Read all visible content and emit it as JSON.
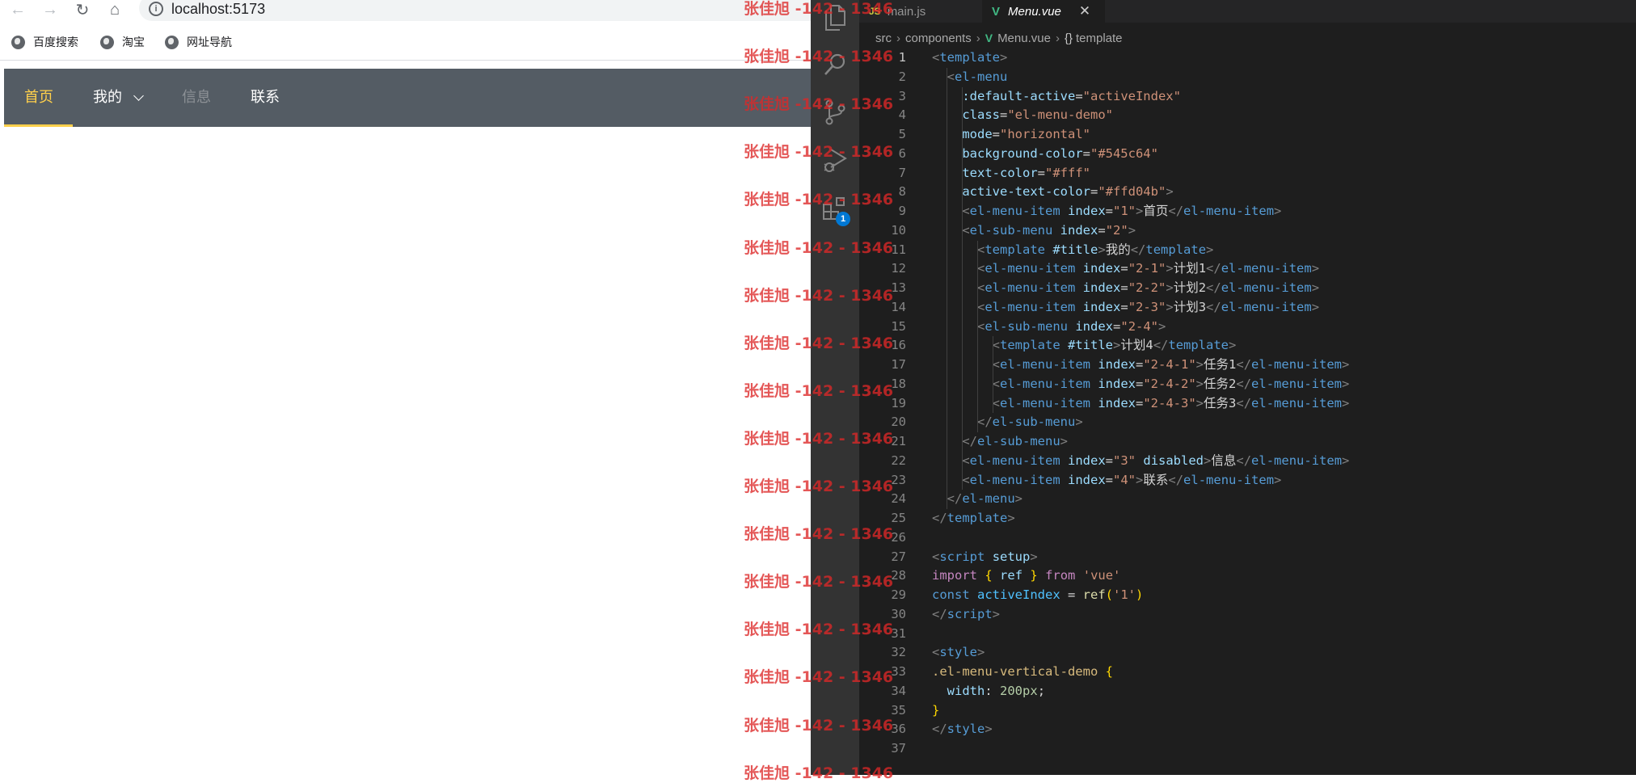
{
  "browser": {
    "nav": {
      "back_icon": "←",
      "forward_icon": "→",
      "reload_icon": "↻",
      "home_icon": "⌂"
    },
    "url": "localhost:5173",
    "bookmarks": [
      "百度搜索",
      "淘宝",
      "网址导航"
    ],
    "menu": {
      "items": [
        {
          "label": "首页",
          "state": "active"
        },
        {
          "label": "我的",
          "state": "submenu"
        },
        {
          "label": "信息",
          "state": "disabled"
        },
        {
          "label": "联系",
          "state": "normal"
        }
      ],
      "background_color": "#545c64",
      "text_color": "#fff",
      "active_text_color": "#ffd04b"
    }
  },
  "watermark": {
    "text": "张佳旭 -142 - 1346",
    "count": 17
  },
  "vscode": {
    "activity_icons": [
      "files-icon",
      "search-icon",
      "source-control-icon",
      "run-debug-icon",
      "extensions-icon"
    ],
    "extensions_badge": "1",
    "tabs": [
      {
        "badge": "JS",
        "label": "main.js",
        "active": false
      },
      {
        "badge": "V",
        "label": "Menu.vue",
        "active": true,
        "close": "✕"
      }
    ],
    "breadcrumbs": [
      "src",
      "components",
      "Menu.vue",
      "template"
    ],
    "current_line": 1,
    "code_lines": [
      [
        [
          "t-br",
          "<"
        ],
        [
          "t-tag",
          "template"
        ],
        [
          "t-br",
          ">"
        ]
      ],
      [
        [
          "",
          "  "
        ],
        [
          "t-br",
          "<"
        ],
        [
          "t-tag",
          "el-menu"
        ]
      ],
      [
        [
          "",
          "    "
        ],
        [
          "t-attr",
          ":default-active"
        ],
        [
          "",
          "="
        ],
        [
          "t-str",
          "\"activeIndex\""
        ]
      ],
      [
        [
          "",
          "    "
        ],
        [
          "t-attr",
          "class"
        ],
        [
          "",
          "="
        ],
        [
          "t-str",
          "\"el-menu-demo\""
        ]
      ],
      [
        [
          "",
          "    "
        ],
        [
          "t-attr",
          "mode"
        ],
        [
          "",
          "="
        ],
        [
          "t-str",
          "\"horizontal\""
        ]
      ],
      [
        [
          "",
          "    "
        ],
        [
          "t-attr",
          "background-color"
        ],
        [
          "",
          "="
        ],
        [
          "t-str",
          "\"#545c64\""
        ]
      ],
      [
        [
          "",
          "    "
        ],
        [
          "t-attr",
          "text-color"
        ],
        [
          "",
          "="
        ],
        [
          "t-str",
          "\"#fff\""
        ]
      ],
      [
        [
          "",
          "    "
        ],
        [
          "t-attr",
          "active-text-color"
        ],
        [
          "",
          "="
        ],
        [
          "t-str",
          "\"#ffd04b\""
        ],
        [
          "t-br",
          ">"
        ]
      ],
      [
        [
          "",
          "    "
        ],
        [
          "t-br",
          "<"
        ],
        [
          "t-tag",
          "el-menu-item"
        ],
        [
          "",
          " "
        ],
        [
          "t-attr",
          "index"
        ],
        [
          "",
          "="
        ],
        [
          "t-str",
          "\"1\""
        ],
        [
          "t-br",
          ">"
        ],
        [
          "",
          "首页"
        ],
        [
          "t-br",
          "</"
        ],
        [
          "t-tag",
          "el-menu-item"
        ],
        [
          "t-br",
          ">"
        ]
      ],
      [
        [
          "",
          "    "
        ],
        [
          "t-br",
          "<"
        ],
        [
          "t-tag",
          "el-sub-menu"
        ],
        [
          "",
          " "
        ],
        [
          "t-attr",
          "index"
        ],
        [
          "",
          "="
        ],
        [
          "t-str",
          "\"2\""
        ],
        [
          "t-br",
          ">"
        ]
      ],
      [
        [
          "",
          "      "
        ],
        [
          "t-br",
          "<"
        ],
        [
          "t-tag",
          "template"
        ],
        [
          "",
          " "
        ],
        [
          "t-attr",
          "#title"
        ],
        [
          "t-br",
          ">"
        ],
        [
          "",
          "我的"
        ],
        [
          "t-br",
          "</"
        ],
        [
          "t-tag",
          "template"
        ],
        [
          "t-br",
          ">"
        ]
      ],
      [
        [
          "",
          "      "
        ],
        [
          "t-br",
          "<"
        ],
        [
          "t-tag",
          "el-menu-item"
        ],
        [
          "",
          " "
        ],
        [
          "t-attr",
          "index"
        ],
        [
          "",
          "="
        ],
        [
          "t-str",
          "\"2-1\""
        ],
        [
          "t-br",
          ">"
        ],
        [
          "",
          "计划1"
        ],
        [
          "t-br",
          "</"
        ],
        [
          "t-tag",
          "el-menu-item"
        ],
        [
          "t-br",
          ">"
        ]
      ],
      [
        [
          "",
          "      "
        ],
        [
          "t-br",
          "<"
        ],
        [
          "t-tag",
          "el-menu-item"
        ],
        [
          "",
          " "
        ],
        [
          "t-attr",
          "index"
        ],
        [
          "",
          "="
        ],
        [
          "t-str",
          "\"2-2\""
        ],
        [
          "t-br",
          ">"
        ],
        [
          "",
          "计划2"
        ],
        [
          "t-br",
          "</"
        ],
        [
          "t-tag",
          "el-menu-item"
        ],
        [
          "t-br",
          ">"
        ]
      ],
      [
        [
          "",
          "      "
        ],
        [
          "t-br",
          "<"
        ],
        [
          "t-tag",
          "el-menu-item"
        ],
        [
          "",
          " "
        ],
        [
          "t-attr",
          "index"
        ],
        [
          "",
          "="
        ],
        [
          "t-str",
          "\"2-3\""
        ],
        [
          "t-br",
          ">"
        ],
        [
          "",
          "计划3"
        ],
        [
          "t-br",
          "</"
        ],
        [
          "t-tag",
          "el-menu-item"
        ],
        [
          "t-br",
          ">"
        ]
      ],
      [
        [
          "",
          "      "
        ],
        [
          "t-br",
          "<"
        ],
        [
          "t-tag",
          "el-sub-menu"
        ],
        [
          "",
          " "
        ],
        [
          "t-attr",
          "index"
        ],
        [
          "",
          "="
        ],
        [
          "t-str",
          "\"2-4\""
        ],
        [
          "t-br",
          ">"
        ]
      ],
      [
        [
          "",
          "        "
        ],
        [
          "t-br",
          "<"
        ],
        [
          "t-tag",
          "template"
        ],
        [
          "",
          " "
        ],
        [
          "t-attr",
          "#title"
        ],
        [
          "t-br",
          ">"
        ],
        [
          "",
          "计划4"
        ],
        [
          "t-br",
          "</"
        ],
        [
          "t-tag",
          "template"
        ],
        [
          "t-br",
          ">"
        ]
      ],
      [
        [
          "",
          "        "
        ],
        [
          "t-br",
          "<"
        ],
        [
          "t-tag",
          "el-menu-item"
        ],
        [
          "",
          " "
        ],
        [
          "t-attr",
          "index"
        ],
        [
          "",
          "="
        ],
        [
          "t-str",
          "\"2-4-1\""
        ],
        [
          "t-br",
          ">"
        ],
        [
          "",
          "任务1"
        ],
        [
          "t-br",
          "</"
        ],
        [
          "t-tag",
          "el-menu-item"
        ],
        [
          "t-br",
          ">"
        ]
      ],
      [
        [
          "",
          "        "
        ],
        [
          "t-br",
          "<"
        ],
        [
          "t-tag",
          "el-menu-item"
        ],
        [
          "",
          " "
        ],
        [
          "t-attr",
          "index"
        ],
        [
          "",
          "="
        ],
        [
          "t-str",
          "\"2-4-2\""
        ],
        [
          "t-br",
          ">"
        ],
        [
          "",
          "任务2"
        ],
        [
          "t-br",
          "</"
        ],
        [
          "t-tag",
          "el-menu-item"
        ],
        [
          "t-br",
          ">"
        ]
      ],
      [
        [
          "",
          "        "
        ],
        [
          "t-br",
          "<"
        ],
        [
          "t-tag",
          "el-menu-item"
        ],
        [
          "",
          " "
        ],
        [
          "t-attr",
          "index"
        ],
        [
          "",
          "="
        ],
        [
          "t-str",
          "\"2-4-3\""
        ],
        [
          "t-br",
          ">"
        ],
        [
          "",
          "任务3"
        ],
        [
          "t-br",
          "</"
        ],
        [
          "t-tag",
          "el-menu-item"
        ],
        [
          "t-br",
          ">"
        ]
      ],
      [
        [
          "",
          "      "
        ],
        [
          "t-br",
          "</"
        ],
        [
          "t-tag",
          "el-sub-menu"
        ],
        [
          "t-br",
          ">"
        ]
      ],
      [
        [
          "",
          "    "
        ],
        [
          "t-br",
          "</"
        ],
        [
          "t-tag",
          "el-sub-menu"
        ],
        [
          "t-br",
          ">"
        ]
      ],
      [
        [
          "",
          "    "
        ],
        [
          "t-br",
          "<"
        ],
        [
          "t-tag",
          "el-menu-item"
        ],
        [
          "",
          " "
        ],
        [
          "t-attr",
          "index"
        ],
        [
          "",
          "="
        ],
        [
          "t-str",
          "\"3\""
        ],
        [
          "",
          " "
        ],
        [
          "t-attr",
          "disabled"
        ],
        [
          "t-br",
          ">"
        ],
        [
          "",
          "信息"
        ],
        [
          "t-br",
          "</"
        ],
        [
          "t-tag",
          "el-menu-item"
        ],
        [
          "t-br",
          ">"
        ]
      ],
      [
        [
          "",
          "    "
        ],
        [
          "t-br",
          "<"
        ],
        [
          "t-tag",
          "el-menu-item"
        ],
        [
          "",
          " "
        ],
        [
          "t-attr",
          "index"
        ],
        [
          "",
          "="
        ],
        [
          "t-str",
          "\"4\""
        ],
        [
          "t-br",
          ">"
        ],
        [
          "",
          "联系"
        ],
        [
          "t-br",
          "</"
        ],
        [
          "t-tag",
          "el-menu-item"
        ],
        [
          "t-br",
          ">"
        ]
      ],
      [
        [
          "",
          "  "
        ],
        [
          "t-br",
          "</"
        ],
        [
          "t-tag",
          "el-menu"
        ],
        [
          "t-br",
          ">"
        ]
      ],
      [
        [
          "t-br",
          "</"
        ],
        [
          "t-tag",
          "template"
        ],
        [
          "t-br",
          ">"
        ]
      ],
      [],
      [
        [
          "t-br",
          "<"
        ],
        [
          "t-tag",
          "script"
        ],
        [
          "",
          " "
        ],
        [
          "t-attr",
          "setup"
        ],
        [
          "t-br",
          ">"
        ]
      ],
      [
        [
          "t-kw",
          "import"
        ],
        [
          "",
          " "
        ],
        [
          "t-paren",
          "{"
        ],
        [
          "",
          " "
        ],
        [
          "t-attr",
          "ref"
        ],
        [
          "",
          " "
        ],
        [
          "t-paren",
          "}"
        ],
        [
          "",
          " "
        ],
        [
          "t-kw",
          "from"
        ],
        [
          "",
          " "
        ],
        [
          "t-str",
          "'vue'"
        ]
      ],
      [
        [
          "t-kw2",
          "const"
        ],
        [
          "",
          " "
        ],
        [
          "t-var",
          "activeIndex"
        ],
        [
          "",
          " = "
        ],
        [
          "t-fn",
          "ref"
        ],
        [
          "t-paren",
          "("
        ],
        [
          "t-str",
          "'1'"
        ],
        [
          "t-paren",
          ")"
        ]
      ],
      [
        [
          "t-br",
          "</"
        ],
        [
          "t-tag",
          "script"
        ],
        [
          "t-br",
          ">"
        ]
      ],
      [],
      [
        [
          "t-br",
          "<"
        ],
        [
          "t-tag",
          "style"
        ],
        [
          "t-br",
          ">"
        ]
      ],
      [
        [
          "t-sel",
          ".el-menu-vertical-demo"
        ],
        [
          "",
          " "
        ],
        [
          "t-paren",
          "{"
        ]
      ],
      [
        [
          "",
          "  "
        ],
        [
          "t-prop",
          "width"
        ],
        [
          "",
          ": "
        ],
        [
          "t-num",
          "200px"
        ],
        [
          "",
          ";"
        ]
      ],
      [
        [
          "t-paren",
          "}"
        ]
      ],
      [
        [
          "t-br",
          "</"
        ],
        [
          "t-tag",
          "style"
        ],
        [
          "t-br",
          ">"
        ]
      ],
      []
    ]
  }
}
